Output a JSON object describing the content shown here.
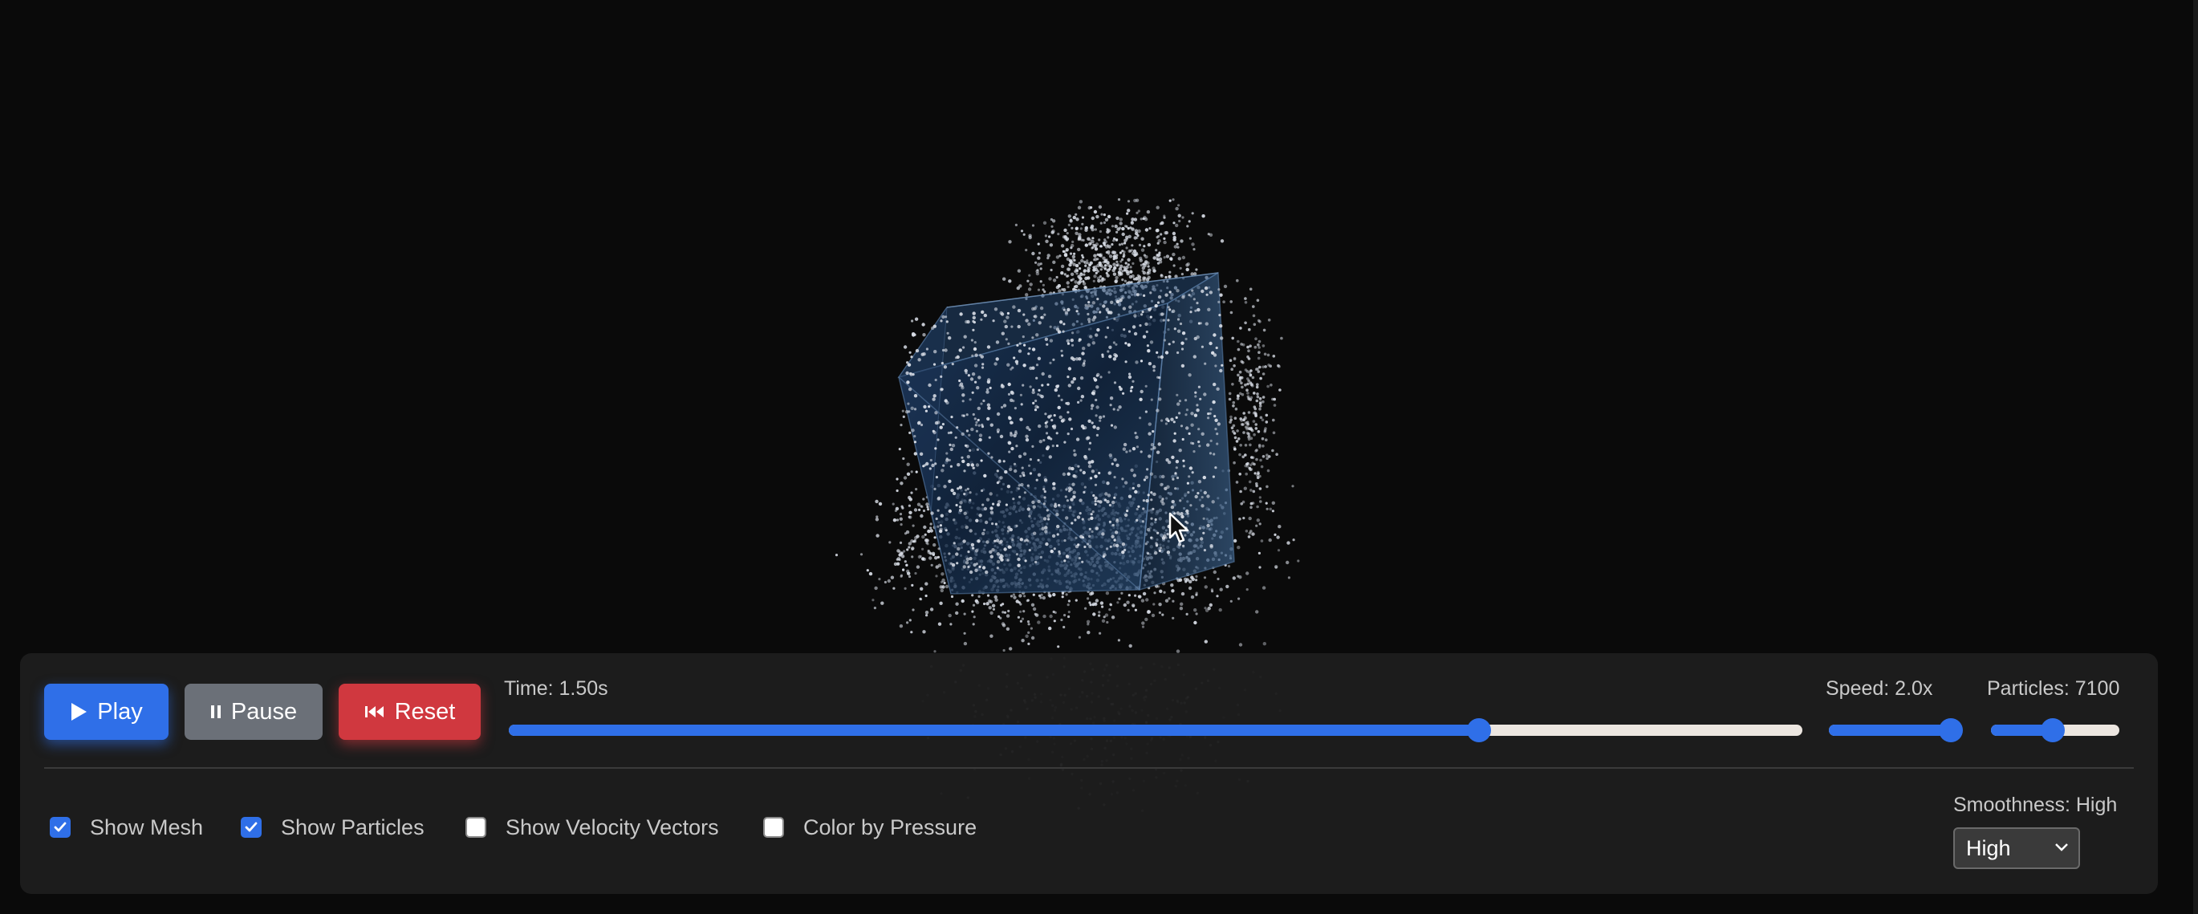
{
  "controls": {
    "play_label": "Play",
    "pause_label": "Pause",
    "reset_label": "Reset"
  },
  "time": {
    "label": "Time: 1.50s",
    "progress": 0.75
  },
  "speed": {
    "label": "Speed: 2.0x",
    "progress": 0.95
  },
  "particles": {
    "label": "Particles: 7100",
    "progress": 0.48
  },
  "toggles": [
    {
      "label": "Show Mesh",
      "checked": true
    },
    {
      "label": "Show Particles",
      "checked": true
    },
    {
      "label": "Show Velocity Vectors",
      "checked": false
    },
    {
      "label": "Color by Pressure",
      "checked": false
    }
  ],
  "smoothness": {
    "label": "Smoothness: High",
    "selected": "High"
  },
  "colors": {
    "accent": "#2f6fe8",
    "pause": "#6b7078",
    "reset": "#d0383f",
    "background": "#0a0a0a",
    "panel": "#1e1e1e",
    "mesh": "#1e3a5f",
    "particle": "#d8dde6"
  },
  "icons": {
    "play": "play-icon",
    "pause": "pause-icon",
    "reset": "skip-back-icon",
    "select": "chevron-down-icon",
    "cursor": "mouse-cursor-icon"
  }
}
